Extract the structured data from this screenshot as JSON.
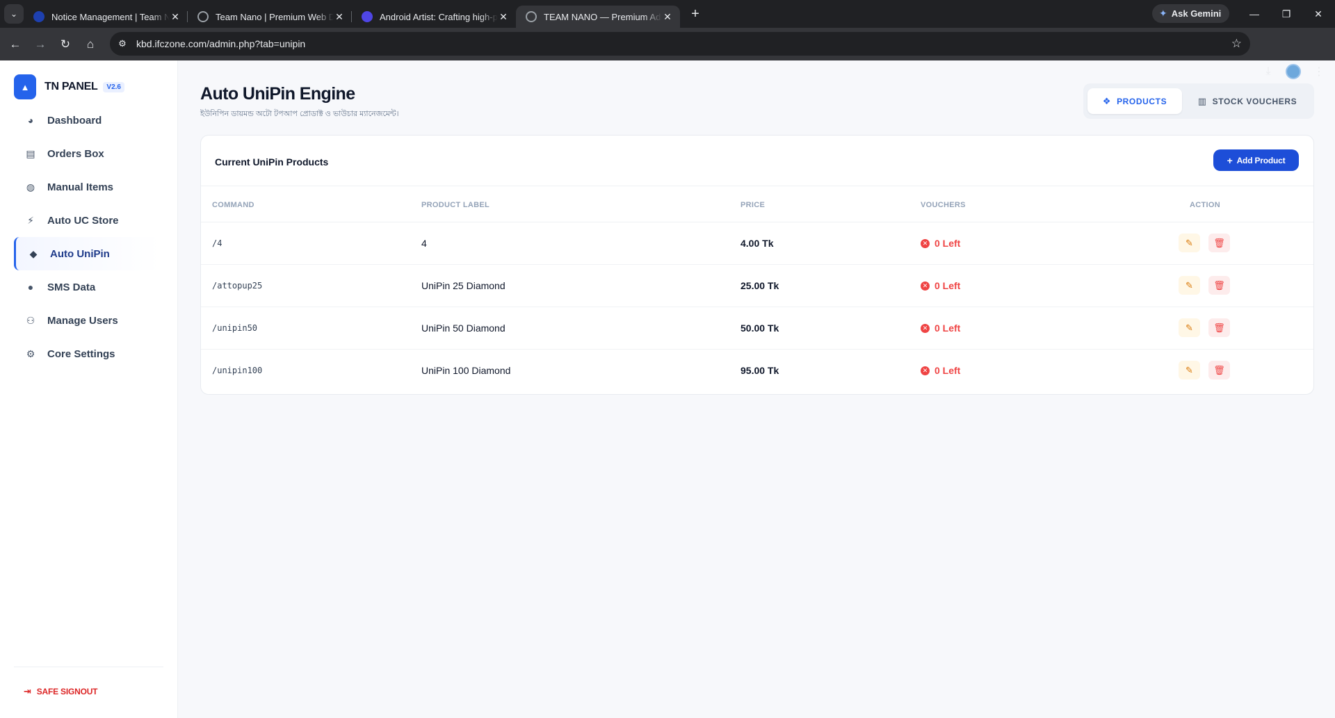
{
  "browser": {
    "tabs": [
      {
        "title": "Notice Management | Team Nano",
        "favicon_color": "#3b82f6"
      },
      {
        "title": "Team Nano | Premium Web Development",
        "favicon_color": "#9aa0a6"
      },
      {
        "title": "Android Artist: Crafting high-performance",
        "favicon_color": "#4f46e5"
      },
      {
        "title": "TEAM NANO — Premium Admin",
        "favicon_color": "#9aa0a6"
      }
    ],
    "active_tab": 3,
    "gemini_label": "Ask Gemini",
    "url": "kbd.ifczone.com/admin.php?tab=unipin"
  },
  "sidebar": {
    "brand": "TN PANEL",
    "version": "V2.6",
    "items": [
      {
        "label": "Dashboard",
        "icon": "chart-pie-icon"
      },
      {
        "label": "Orders Box",
        "icon": "receipt-icon"
      },
      {
        "label": "Manual Items",
        "icon": "gamepad-icon"
      },
      {
        "label": "Auto UC Store",
        "icon": "bolt-icon"
      },
      {
        "label": "Auto UniPin",
        "icon": "gem-icon",
        "active": true
      },
      {
        "label": "SMS Data",
        "icon": "chat-icon"
      },
      {
        "label": "Manage Users",
        "icon": "users-icon"
      },
      {
        "label": "Core Settings",
        "icon": "cogs-icon"
      }
    ],
    "signout_label": "SAFE SIGNOUT"
  },
  "header": {
    "title": "Auto UniPin Engine",
    "subtitle": "ইউনিপিন ডায়মন্ড অটো টপআপ প্রোডাক্ট ও ভাউচার ম্যানেজমেন্ট।"
  },
  "segment": {
    "products_label": "PRODUCTS",
    "vouchers_label": "STOCK VOUCHERS",
    "active": "products"
  },
  "products_card": {
    "title": "Current UniPin Products",
    "add_label": "Add Product",
    "columns": {
      "command": "COMMAND",
      "label": "PRODUCT LABEL",
      "price": "PRICE",
      "vouchers": "VOUCHERS",
      "action": "ACTION"
    },
    "rows": [
      {
        "command": "/4",
        "label": "4",
        "price": "4.00 Tk",
        "vouchers": "0 Left"
      },
      {
        "command": "/attopup25",
        "label": "UniPin 25 Diamond",
        "price": "25.00 Tk",
        "vouchers": "0 Left"
      },
      {
        "command": "/unipin50",
        "label": "UniPin 50 Diamond",
        "price": "50.00 Tk",
        "vouchers": "0 Left"
      },
      {
        "command": "/unipin100",
        "label": "UniPin 100 Diamond",
        "price": "95.00 Tk",
        "vouchers": "0 Left"
      }
    ]
  },
  "colors": {
    "accent": "#2563eb",
    "danger": "#ef4444",
    "warning": "#d97706"
  }
}
